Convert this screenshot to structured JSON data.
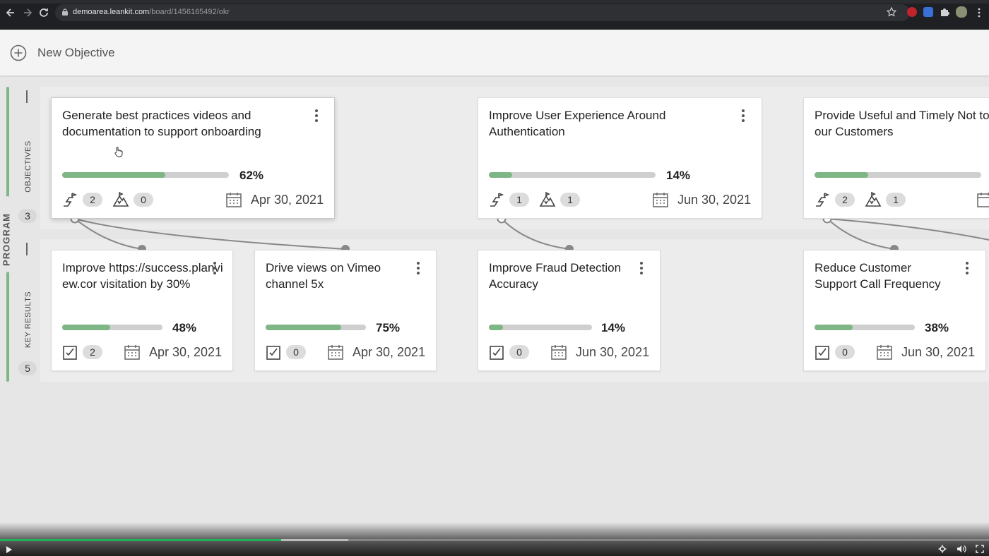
{
  "browser": {
    "url_host": "demoarea.leankit.com",
    "url_path": "/board/1456165492/okr"
  },
  "header": {
    "new_objective_label": "New Objective"
  },
  "lanes": {
    "program_label": "PROGRAM",
    "objectives_label": "OBJECTIVES",
    "objectives_count": "3",
    "key_results_label": "KEY RESULTS",
    "key_results_count": "5"
  },
  "objectives": [
    {
      "title": "Generate best practices videos and documentation to support onboarding",
      "progress": 0.62,
      "percent_label": "62%",
      "key_results_count": "2",
      "risks_count": "0",
      "due_date": "Apr 30, 2021"
    },
    {
      "title": "Improve User Experience Around Authentication",
      "progress": 0.14,
      "percent_label": "14%",
      "key_results_count": "1",
      "risks_count": "1",
      "due_date": "Jun 30, 2021"
    },
    {
      "title": "Provide Useful and Timely Not to our Customers",
      "progress": 0.32,
      "percent_label": "",
      "key_results_count": "2",
      "risks_count": "1",
      "due_date": ""
    }
  ],
  "key_results": [
    {
      "title": "Improve https://success.planview.cor visitation by 30%",
      "progress": 0.48,
      "percent_label": "48%",
      "tasks_count": "2",
      "due_date": "Apr 30, 2021"
    },
    {
      "title": "Drive views on Vimeo channel 5x",
      "progress": 0.75,
      "percent_label": "75%",
      "tasks_count": "0",
      "due_date": "Apr 30, 2021"
    },
    {
      "title": "Improve Fraud Detection Accuracy",
      "progress": 0.14,
      "percent_label": "14%",
      "tasks_count": "0",
      "due_date": "Jun 30, 2021"
    },
    {
      "title": "Reduce Customer Support Call Frequency",
      "progress": 0.38,
      "percent_label": "38%",
      "tasks_count": "0",
      "due_date": "Jun 30, 2021"
    }
  ],
  "video_player": {
    "played_fraction": 0.284,
    "buffered_fraction": 0.352
  },
  "colors": {
    "accent_green": "#7fb685",
    "player_green": "#1fb25a"
  },
  "icons": [
    "back-icon",
    "forward-icon",
    "reload-icon",
    "lock-icon",
    "star-icon",
    "plus-circle-icon",
    "kebab-menu-icon",
    "key-result-flag-icon",
    "risk-mountain-icon",
    "calendar-icon",
    "checkbox-icon",
    "play-icon",
    "settings-icon",
    "volume-icon",
    "fullscreen-icon"
  ]
}
